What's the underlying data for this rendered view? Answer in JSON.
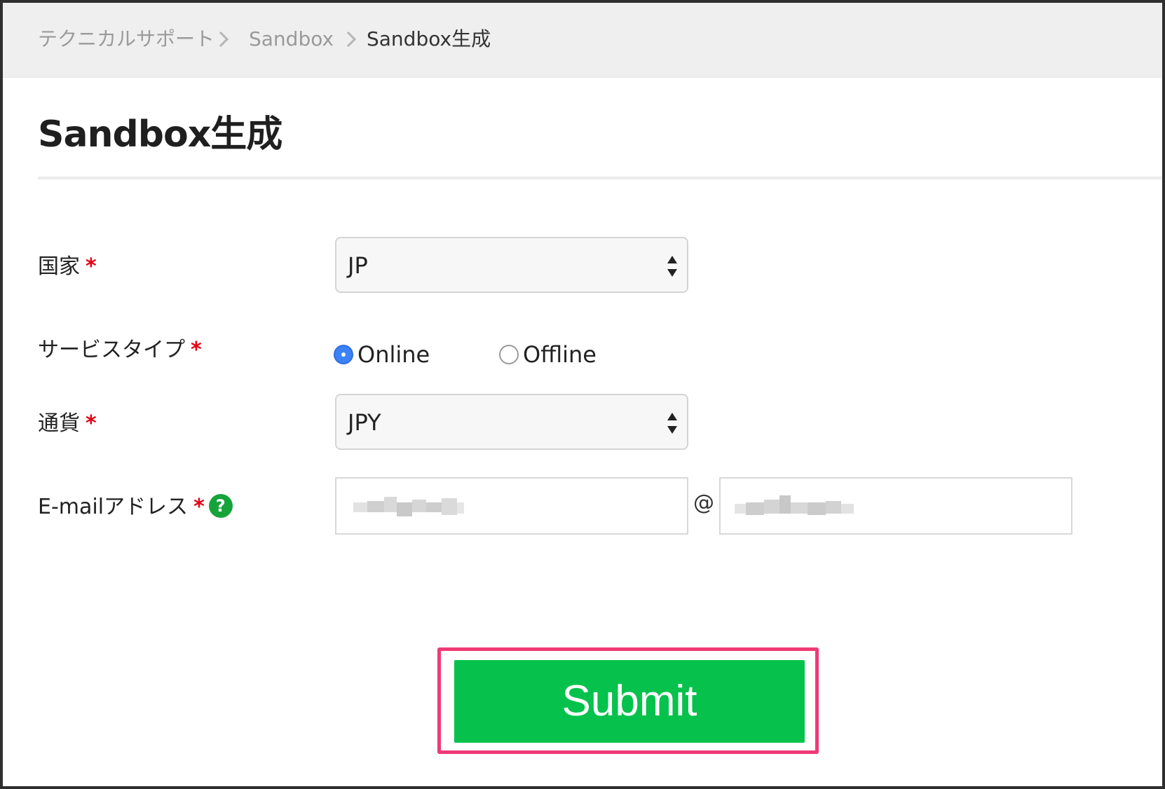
{
  "breadcrumb": {
    "items": [
      {
        "label": "テクニカルサポート"
      },
      {
        "label": "Sandbox"
      },
      {
        "label": "Sandbox生成"
      }
    ]
  },
  "page": {
    "title": "Sandbox生成"
  },
  "form": {
    "country": {
      "label": "国家",
      "required_mark": "*",
      "value": "JP"
    },
    "service_type": {
      "label": "サービスタイプ",
      "required_mark": "*",
      "options": [
        {
          "label": "Online",
          "selected": true
        },
        {
          "label": "Offline",
          "selected": false
        }
      ]
    },
    "currency": {
      "label": "通貨",
      "required_mark": "*",
      "value": "JPY"
    },
    "email": {
      "label": "E-mailアドレス",
      "required_mark": "*",
      "help_glyph": "?",
      "at_sign": "@"
    },
    "submit": {
      "label": "Submit"
    }
  },
  "colors": {
    "submit_bg": "#06c24c",
    "highlight_border": "#ee3a75",
    "required": "#e60012",
    "help_icon": "#16a33a",
    "radio_selected": "#3b82f6"
  }
}
